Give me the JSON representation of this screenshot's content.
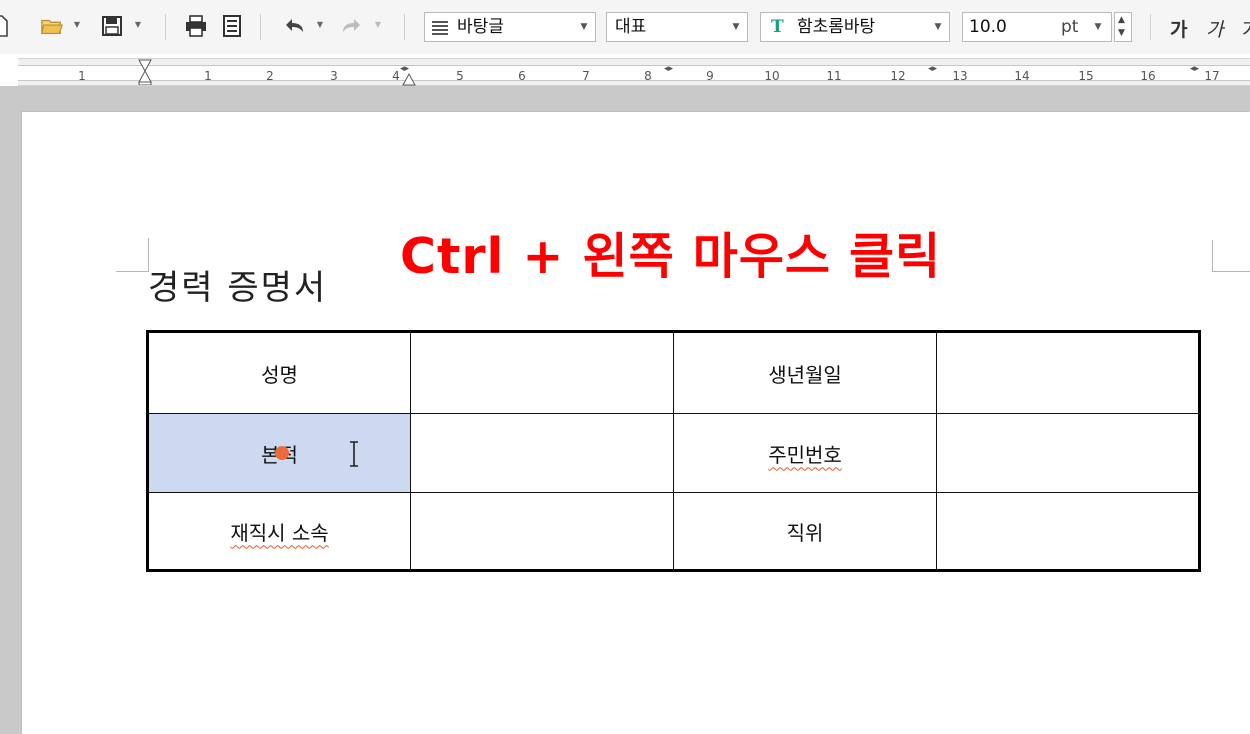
{
  "toolbar": {
    "style_combo": "바탕글",
    "lang_combo": "대표",
    "font_combo": "함초롬바탕",
    "font_size": "10.0",
    "size_unit": "pt",
    "font_bold_1": "가",
    "font_bold_2": "가",
    "icons": [
      "new-document-icon",
      "open-folder-icon",
      "save-icon",
      "print-icon",
      "preview-icon",
      "undo-icon",
      "redo-icon",
      "align-icon",
      "font-type-icon"
    ]
  },
  "ruler": {
    "numbers": [
      "1",
      "1",
      "2",
      "3",
      "4",
      "5",
      "6",
      "7",
      "8",
      "9",
      "10",
      "11",
      "12",
      "13",
      "14",
      "15",
      "16",
      "17"
    ]
  },
  "document": {
    "title": "경력 증명서",
    "annotation": "Ctrl + 왼쪽 마우스 클릭",
    "annotation_color": "#ff0000",
    "table": {
      "rows": [
        [
          "성명",
          "",
          "생년월일",
          ""
        ],
        [
          "본적",
          "",
          "주민번호",
          ""
        ],
        [
          "재직시 소속",
          "",
          "직위",
          ""
        ]
      ]
    }
  },
  "colors": {
    "selection": "#cdd9f1",
    "click_marker": "#ef6a3a"
  }
}
